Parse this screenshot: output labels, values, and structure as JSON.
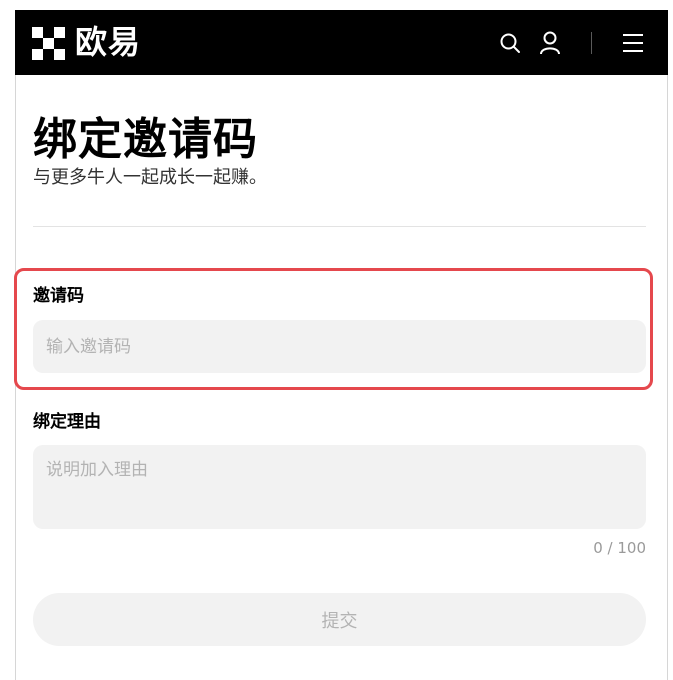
{
  "header": {
    "brand_text": "欧易",
    "icons": [
      "okx-logo-icon",
      "search-icon",
      "user-icon",
      "menu-icon"
    ],
    "background_color": "#000000"
  },
  "page": {
    "title": "绑定邀请码",
    "subtitle": "与更多牛人一起成长一起赚。"
  },
  "invite_code": {
    "label": "邀请码",
    "value": "",
    "placeholder": "输入邀请码",
    "highlight_color": "#e5484d"
  },
  "reason": {
    "label": "绑定理由",
    "value": "",
    "placeholder": "说明加入理由",
    "counter": "0 / 100"
  },
  "submit": {
    "label": "提交",
    "disabled": true
  }
}
